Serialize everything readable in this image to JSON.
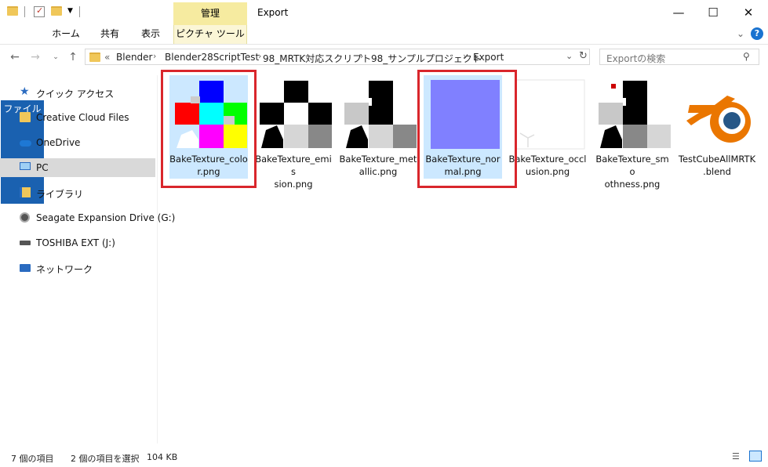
{
  "window": {
    "title": "Export",
    "context_tab_group": "管理"
  },
  "ribbon": {
    "tabs": [
      "ファイル",
      "ホーム",
      "共有",
      "表示",
      "ピクチャ ツール"
    ]
  },
  "address": {
    "overflow": "«",
    "crumbs": [
      "Blender",
      "Blender28ScriptTest",
      "98_MRTK対応スクリプト",
      "98_サンプルプロジェクト",
      "Export"
    ]
  },
  "search": {
    "placeholder": "Exportの検索"
  },
  "sidebar": {
    "items": [
      {
        "label": "クイック アクセス",
        "icon": "star-icon"
      },
      {
        "label": "Creative Cloud Files",
        "icon": "creative-cloud-folder-icon"
      },
      {
        "label": "OneDrive",
        "icon": "cloud-icon"
      },
      {
        "label": "PC",
        "icon": "monitor-icon",
        "selected": true
      },
      {
        "label": "ライブラリ",
        "icon": "library-folder-icon"
      },
      {
        "label": "Seagate Expansion Drive (G:)",
        "icon": "drive-icon"
      },
      {
        "label": "TOSHIBA EXT (J:)",
        "icon": "usb-drive-icon"
      },
      {
        "label": "ネットワーク",
        "icon": "network-icon"
      }
    ]
  },
  "files": [
    {
      "name": "BakeTexture_color.png",
      "line1": "BakeTexture_colo",
      "line2": "r.png",
      "selected": true,
      "highlighted": true
    },
    {
      "name": "BakeTexture_emission.png",
      "line1": "BakeTexture_emis",
      "line2": "sion.png"
    },
    {
      "name": "BakeTexture_metallic.png",
      "line1": "BakeTexture_met",
      "line2": "allic.png"
    },
    {
      "name": "BakeTexture_normal.png",
      "line1": "BakeTexture_nor",
      "line2": "mal.png",
      "selected": true,
      "highlighted": true
    },
    {
      "name": "BakeTexture_occlusion.png",
      "line1": "BakeTexture_occl",
      "line2": "usion.png"
    },
    {
      "name": "BakeTexture_smoothness.png",
      "line1": "BakeTexture_smo",
      "line2": "othness.png"
    },
    {
      "name": "TestCubeAllMRTK.blend",
      "line1": "TestCubeAllMRTK",
      "line2": ".blend"
    }
  ],
  "status": {
    "item_count": "7 個の項目",
    "selection": "2 個の項目を選択",
    "size": "104 KB"
  },
  "colors": {
    "selection": "#cce8ff",
    "highlight": "#d9262c",
    "file_tab": "#1a61b0",
    "context_tab": "#f6eba0",
    "normal_map": "#8080ff"
  }
}
